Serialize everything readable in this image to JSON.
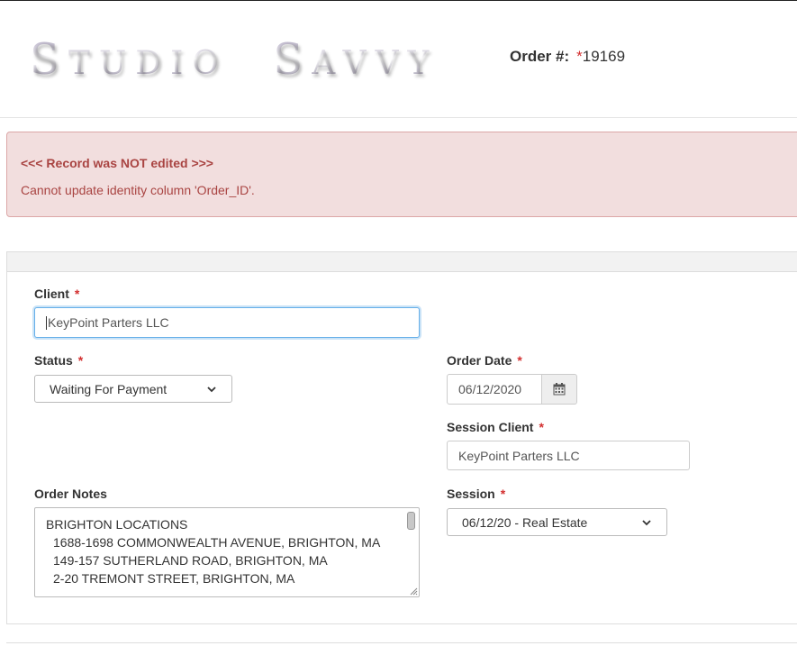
{
  "header": {
    "logo_first_initial": "S",
    "logo_first_rest": "TUDIO",
    "logo_second_initial": "S",
    "logo_second_rest": "AVVY",
    "order_label": "Order #:",
    "order_required_mark": "*",
    "order_number": "19169"
  },
  "alert": {
    "title": "<<< Record was NOT edited >>>",
    "message": "Cannot update identity column 'Order_ID'."
  },
  "form": {
    "required_mark": "*",
    "client": {
      "label": "Client",
      "value": "KeyPoint Parters LLC"
    },
    "status": {
      "label": "Status",
      "selected": "Waiting For Payment"
    },
    "order_date": {
      "label": "Order Date",
      "value": "06/12/2020"
    },
    "session_client": {
      "label": "Session Client",
      "value": "KeyPoint Parters LLC"
    },
    "order_notes": {
      "label": "Order Notes",
      "lines": [
        "BRIGHTON LOCATIONS",
        "1688-1698 COMMONWEALTH AVENUE, BRIGHTON, MA",
        "149-157 SUTHERLAND ROAD, BRIGHTON, MA",
        "2-20 TREMONT STREET, BRIGHTON, MA"
      ]
    },
    "session": {
      "label": "Session",
      "selected": "06/12/20 - Real Estate"
    }
  },
  "icons": {
    "calendar": "calendar-icon",
    "chevron": "chevron-down-icon"
  },
  "colors": {
    "alert_bg": "#f2dede",
    "alert_text": "#a94442",
    "required": "#d32f2f",
    "focus": "#66afe9"
  }
}
